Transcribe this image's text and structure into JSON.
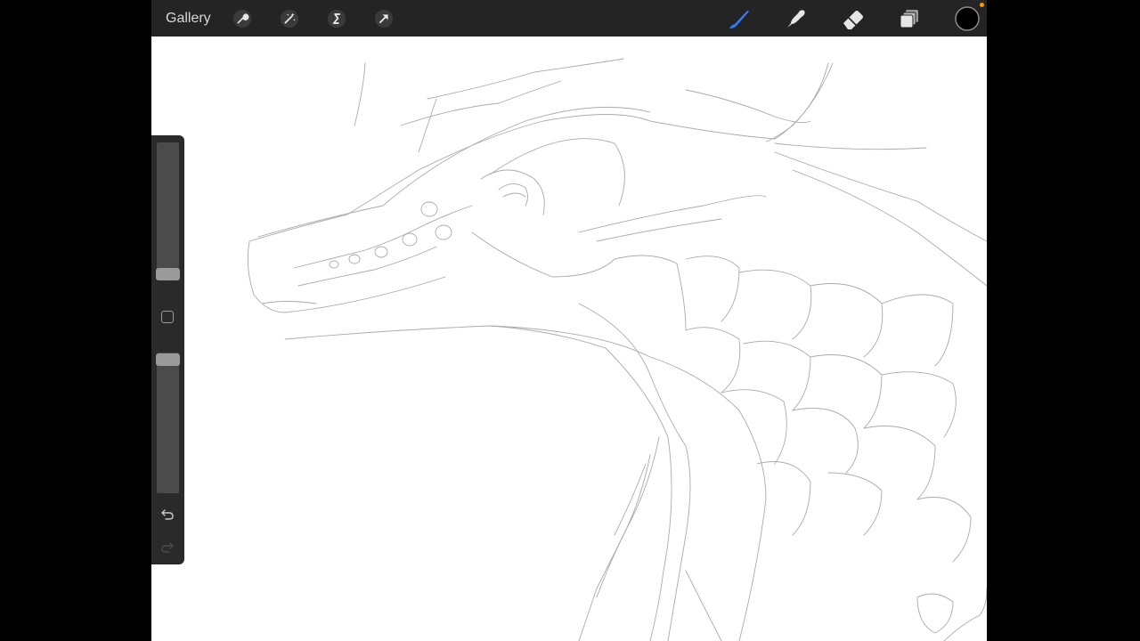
{
  "topbar": {
    "gallery_label": "Gallery",
    "actions": [
      {
        "name": "actions-wrench-icon"
      },
      {
        "name": "adjustments-wand-icon"
      },
      {
        "name": "selection-s-icon"
      },
      {
        "name": "transform-arrow-icon"
      }
    ],
    "tools": [
      {
        "name": "brush-icon",
        "active": true
      },
      {
        "name": "smudge-icon",
        "active": false
      },
      {
        "name": "eraser-icon",
        "active": false
      },
      {
        "name": "layers-icon",
        "active": false
      }
    ],
    "current_color": "#000000",
    "colors": {
      "bar": "#242424",
      "active_tool": "#2f7cf6",
      "icon": "#e6e6e6",
      "notification_dot": "#ff9500"
    }
  },
  "sidebar": {
    "brush_size_level": 0.2,
    "opacity_level": 1.0,
    "icons": [
      "modify-square-icon",
      "undo-icon",
      "redo-icon"
    ]
  }
}
